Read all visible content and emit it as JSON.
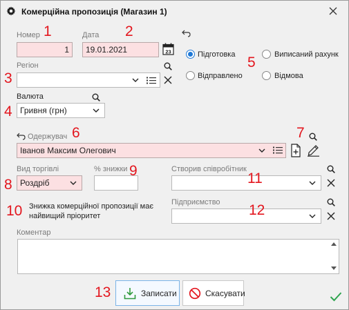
{
  "window": {
    "title": "Комерційна пропозиція (Магазин 1)"
  },
  "markers": [
    "1",
    "2",
    "3",
    "4",
    "5",
    "6",
    "7",
    "8",
    "9",
    "10",
    "11",
    "12",
    "13"
  ],
  "number": {
    "label": "Номер",
    "value": "1"
  },
  "date": {
    "label": "Дата",
    "value": "19.01.2021"
  },
  "region": {
    "label": "Регіон",
    "value": ""
  },
  "currency": {
    "label": "Валюта",
    "value": "Гривня (грн)"
  },
  "status": {
    "options": [
      "Підготовка",
      "Виписаний рахунок",
      "Відправлено",
      "Відмова"
    ],
    "visible": [
      "Підготовка",
      "Виписаний рахунк",
      "Відправлено",
      "Відмова"
    ],
    "selected": "Підготовка"
  },
  "recipient": {
    "label": "Одержувач",
    "value": "Іванов Максим Олегович"
  },
  "trade_type": {
    "label": "Вид торгівлі",
    "value": "Роздріб"
  },
  "discount_pct": {
    "label": "% знижки",
    "value": ""
  },
  "created_by": {
    "label": "Створив співробітник",
    "value": ""
  },
  "enterprise": {
    "label": "Підприємство",
    "value": ""
  },
  "priority_note": {
    "line1": "Знижка комерційної пропозиції  має",
    "line2": "найвищий пріоритет"
  },
  "comment": {
    "label": "Коментар",
    "value": ""
  },
  "buttons": {
    "save": "Записати",
    "cancel": "Скасувати"
  },
  "colors": {
    "accent": "#1e78d6",
    "marker": "#e3161e",
    "required_bg": "#fce0e2",
    "ok_check": "#2ea44f"
  }
}
